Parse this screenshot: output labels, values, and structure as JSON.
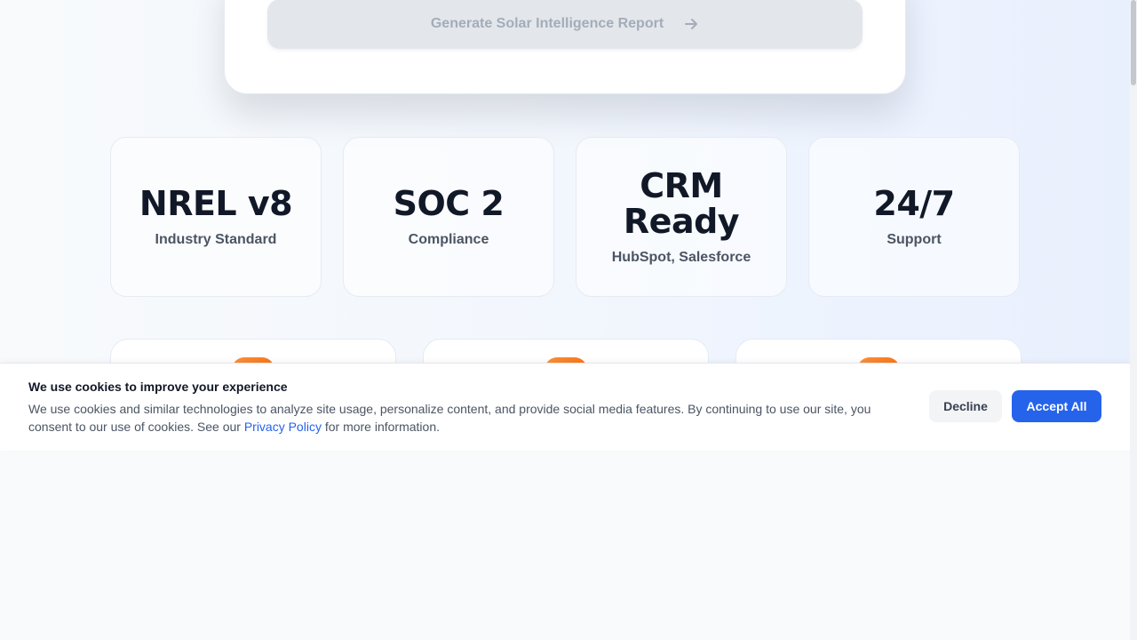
{
  "report_form": {
    "generate_label": "Generate Solar Intelligence Report",
    "generate_icon": "arrow-right-icon"
  },
  "stats": [
    {
      "value": "NREL v8",
      "label": "Industry Standard"
    },
    {
      "value": "SOC 2",
      "label": "Compliance"
    },
    {
      "value": "CRM Ready",
      "label": "HubSpot, Salesforce"
    },
    {
      "value": "24/7",
      "label": "Support"
    }
  ],
  "features": [
    {
      "icon": "feature-icon"
    },
    {
      "icon": "feature-icon"
    },
    {
      "icon": "feature-icon"
    }
  ],
  "cookie_banner": {
    "title": "We use cookies to improve your experience",
    "text_before_link": "We use cookies and similar technologies to analyze site usage, personalize content, and provide social media features. By continuing to use our site, you consent to our use of cookies. See our ",
    "link_label": "Privacy Policy",
    "text_after_link": " for more information.",
    "decline_label": "Decline",
    "accept_label": "Accept All"
  },
  "colors": {
    "accent": "#2563eb",
    "feature_icon": "#f97316",
    "heading": "#111827"
  }
}
